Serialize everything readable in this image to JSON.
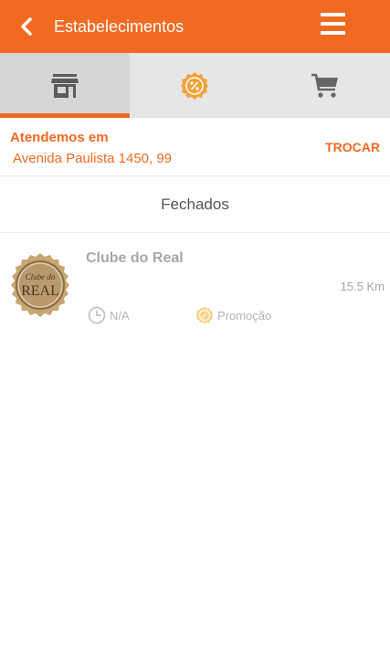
{
  "header": {
    "title": "Estabelecimentos",
    "background_color": "#f26a21",
    "back_icon": "chevron-left-icon",
    "menu_icon": "hamburger-menu-icon"
  },
  "tabs": [
    {
      "icon": "store-icon",
      "active": true
    },
    {
      "icon": "discount-badge-icon",
      "active": false
    },
    {
      "icon": "cart-icon",
      "active": false
    }
  ],
  "location": {
    "label": "Atendemos em",
    "address": "Avenida Paulista 1450, 99",
    "change_label": "TROCAR"
  },
  "section": {
    "title": "Fechados"
  },
  "stores": [
    {
      "name": "Clube do Real",
      "logo_text_top": "Clube do",
      "logo_text_main": "REAL",
      "distance": "15.5 Km",
      "hours": "N/A",
      "promo": "Promoção"
    }
  ],
  "colors": {
    "accent": "#f26a21",
    "tab_bar": "#e6e6e6",
    "tab_active": "#d6d6d6",
    "muted_text": "#a8a8a8"
  }
}
